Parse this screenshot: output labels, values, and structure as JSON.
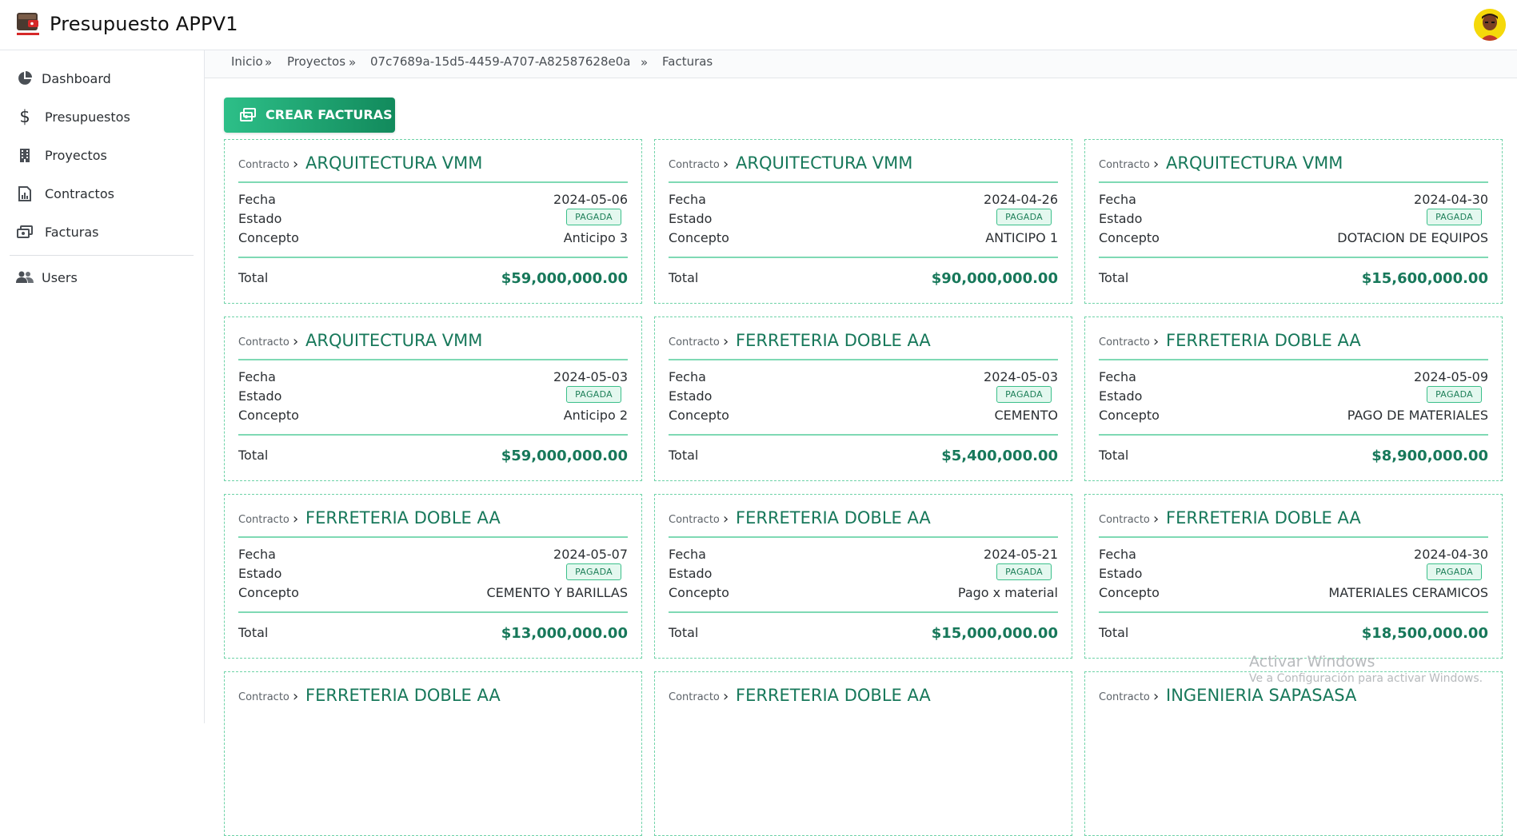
{
  "header": {
    "title": "Presupuesto APPV1",
    "logo_icon": "wallet-logo-icon",
    "avatar_icon": "user-avatar"
  },
  "sidebar": {
    "items": [
      {
        "label": "Dashboard",
        "icon": "pie-chart-icon"
      },
      {
        "label": "Presupuestos",
        "icon": "dollar-icon"
      },
      {
        "label": "Proyectos",
        "icon": "building-icon"
      },
      {
        "label": "Contractos",
        "icon": "document-chart-icon"
      },
      {
        "label": "Facturas",
        "icon": "money-icon"
      },
      {
        "label": "Users",
        "icon": "users-icon"
      }
    ]
  },
  "breadcrumb": {
    "items": [
      "Inicio",
      "Proyectos",
      "07c7689a-15d5-4459-A707-A82587628e0a",
      "Facturas"
    ],
    "separator": "»"
  },
  "actions": {
    "create_label": "CREAR FACTURAS"
  },
  "labels": {
    "contract": "Contracto",
    "date": "Fecha",
    "state": "Estado",
    "concept": "Concepto",
    "total": "Total"
  },
  "invoices": [
    {
      "contract": "ARQUITECTURA VMM",
      "date": "2024-05-06",
      "state": "PAGADA",
      "concept": "Anticipo 3",
      "total": "$59,000,000.00"
    },
    {
      "contract": "ARQUITECTURA VMM",
      "date": "2024-04-26",
      "state": "PAGADA",
      "concept": "ANTICIPO 1",
      "total": "$90,000,000.00"
    },
    {
      "contract": "ARQUITECTURA VMM",
      "date": "2024-04-30",
      "state": "PAGADA",
      "concept": "DOTACION DE EQUIPOS",
      "total": "$15,600,000.00"
    },
    {
      "contract": "ARQUITECTURA VMM",
      "date": "2024-05-03",
      "state": "PAGADA",
      "concept": "Anticipo 2",
      "total": "$59,000,000.00"
    },
    {
      "contract": "FERRETERIA DOBLE AA",
      "date": "2024-05-03",
      "state": "PAGADA",
      "concept": "CEMENTO",
      "total": "$5,400,000.00"
    },
    {
      "contract": "FERRETERIA DOBLE AA",
      "date": "2024-05-09",
      "state": "PAGADA",
      "concept": "PAGO DE MATERIALES",
      "total": "$8,900,000.00"
    },
    {
      "contract": "FERRETERIA DOBLE AA",
      "date": "2024-05-07",
      "state": "PAGADA",
      "concept": "CEMENTO Y BARILLAS",
      "total": "$13,000,000.00"
    },
    {
      "contract": "FERRETERIA DOBLE AA",
      "date": "2024-05-21",
      "state": "PAGADA",
      "concept": "Pago x material",
      "total": "$15,000,000.00"
    },
    {
      "contract": "FERRETERIA DOBLE AA",
      "date": "2024-04-30",
      "state": "PAGADA",
      "concept": "MATERIALES CERAMICOS",
      "total": "$18,500,000.00"
    },
    {
      "contract": "FERRETERIA DOBLE AA"
    },
    {
      "contract": "FERRETERIA DOBLE AA"
    },
    {
      "contract": "INGENIERIA SAPASASA"
    }
  ],
  "watermark": {
    "line1": "Activar Windows",
    "line2": "Ve a Configuración para activar Windows."
  },
  "colors": {
    "accent": "#17785a",
    "badge_bg": "#e4f8ef",
    "border": "#6fd3a8",
    "button_start": "#2dbf88",
    "button_end": "#128a5c"
  }
}
